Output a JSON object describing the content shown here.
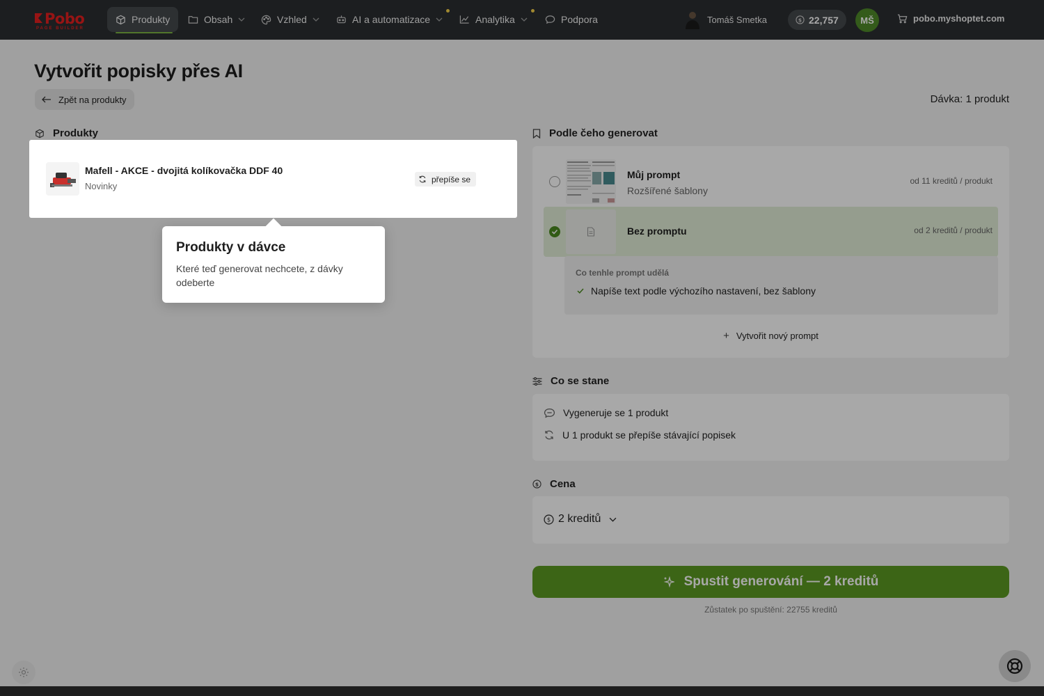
{
  "app": {
    "logo_text": "Pobo",
    "logo_sub": "PAGE BUILDER"
  },
  "nav": {
    "items": [
      {
        "label": "Produkty",
        "icon": "box-icon",
        "active": true
      },
      {
        "label": "Obsah",
        "icon": "folder-icon"
      },
      {
        "label": "Vzhled",
        "icon": "palette-icon"
      },
      {
        "label": "AI a automatizace",
        "icon": "robot-icon"
      },
      {
        "label": "Analytika",
        "icon": "chart-icon"
      },
      {
        "label": "Podpora",
        "icon": "chat-icon"
      }
    ],
    "user_name": "Tomáš Smetka",
    "credits": "22,757",
    "avatar_initials": "MŠ",
    "shop_url": "pobo.myshoptet.com"
  },
  "page": {
    "title": "Vytvořit popisky přes AI",
    "back_label": "Zpět na produkty",
    "batch_count": "Dávka: 1 produkt"
  },
  "products": {
    "heading": "Produkty",
    "items": [
      {
        "name": "Mafell - AKCE - dvojitá kolíkovačka DDF 40",
        "category": "Novinky",
        "badge": "přepíše se"
      }
    ]
  },
  "prompt": {
    "heading": "Podle čeho generovat",
    "options": [
      {
        "title": "Můj prompt",
        "subtitle": "Rozšířené šablony",
        "price": "od 11 kreditů / produkt",
        "selected": false
      },
      {
        "title": "Bez promptu",
        "subtitle": "",
        "price": "od 2 kreditů / produkt",
        "selected": true
      }
    ],
    "explain_heading": "Co tenhle prompt udělá",
    "explain_item": "Napíše text podle výchozího nastavení, bez šablony",
    "new_prompt": "Vytvořit nový prompt"
  },
  "happen": {
    "heading": "Co se stane",
    "rows": [
      "Vygeneruje se 1 produkt",
      "U 1 produkt se přepíše stávající popisek"
    ]
  },
  "price": {
    "heading": "Cena",
    "value": "2 kreditů"
  },
  "start": {
    "label": "Spustit generování — 2 kreditů",
    "remaining": "Zůstatek po spuštění: 22755 kreditů"
  },
  "tooltip": {
    "title": "Produkty v dávce",
    "text": "Které teď generovat nechcete, z dávky odeberte"
  },
  "colors": {
    "accent": "#5c9a22",
    "nav_bg": "#2b2e31",
    "logo": "#e51f1f",
    "selected_bg": "#e3efd8"
  }
}
